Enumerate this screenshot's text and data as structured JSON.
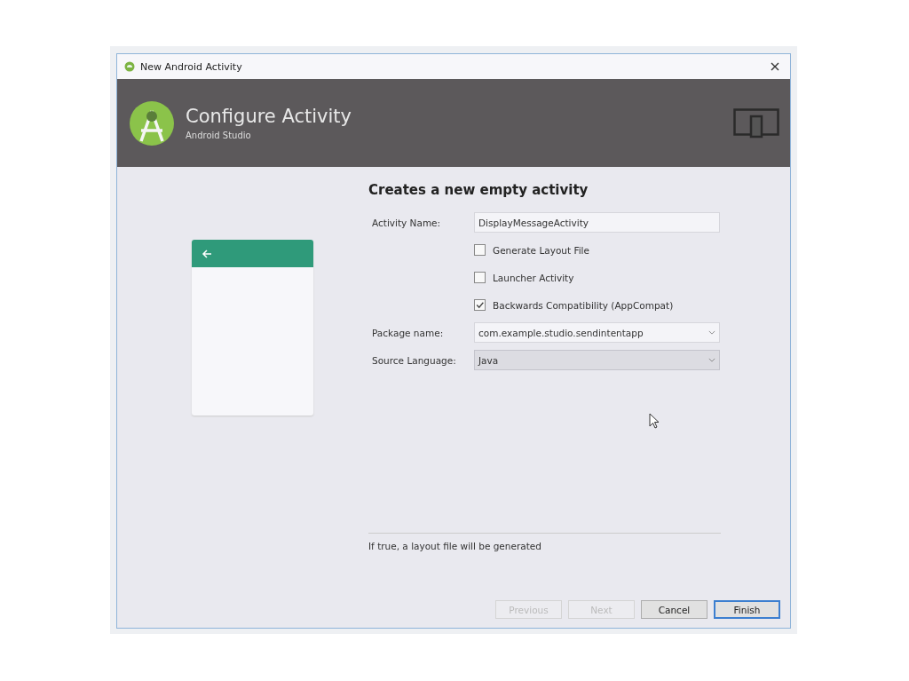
{
  "window": {
    "title": "New Android Activity"
  },
  "header": {
    "title": "Configure Activity",
    "subtitle": "Android Studio"
  },
  "heading": "Creates a new empty activity",
  "form": [
    {
      "kind": "text",
      "label": "Activity Name:",
      "value": "DisplayMessageActivity"
    },
    {
      "kind": "checkbox",
      "label": "Generate Layout File",
      "checked": false
    },
    {
      "kind": "checkbox",
      "label": "Launcher Activity",
      "checked": false
    },
    {
      "kind": "checkbox",
      "label": "Backwards Compatibility (AppCompat)",
      "checked": true
    },
    {
      "kind": "select",
      "label": "Package name:",
      "value": "com.example.studio.sendintentapp",
      "disabled": false
    },
    {
      "kind": "select",
      "label": "Source Language:",
      "value": "Java",
      "disabled": true
    }
  ],
  "help": "If true, a layout file will be generated",
  "buttons": [
    {
      "label": "Previous",
      "disabled": true,
      "default": false
    },
    {
      "label": "Next",
      "disabled": true,
      "default": false
    },
    {
      "label": "Cancel",
      "disabled": false,
      "default": false
    },
    {
      "label": "Finish",
      "disabled": false,
      "default": true
    }
  ]
}
